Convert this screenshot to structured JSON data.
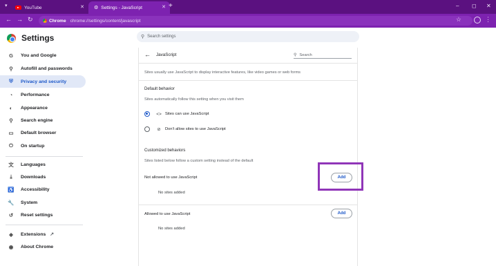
{
  "browser": {
    "tabs": [
      {
        "title": "YouTube",
        "icon": "youtube-logo-icon"
      },
      {
        "title": "Settings - JavaScript",
        "icon": "gear-icon"
      }
    ],
    "new_tab_glyph": "+",
    "address": {
      "chip_label": "Chrome",
      "url": "chrome://settings/content/javascript"
    },
    "colors": {
      "tabstrip": "#5b1180",
      "toolbar": "#7d22b0"
    }
  },
  "header": {
    "title": "Settings",
    "search_placeholder": "Search settings"
  },
  "sidebar": {
    "items": [
      {
        "label": "You and Google",
        "icon": "google-g-icon",
        "active": false
      },
      {
        "label": "Autofill and passwords",
        "icon": "key-icon",
        "active": false
      },
      {
        "label": "Privacy and security",
        "icon": "shield-icon",
        "active": true
      },
      {
        "label": "Performance",
        "icon": "speedometer-icon",
        "active": false
      },
      {
        "label": "Appearance",
        "icon": "palette-icon",
        "active": false
      },
      {
        "label": "Search engine",
        "icon": "search-icon",
        "active": false
      },
      {
        "label": "Default browser",
        "icon": "browser-window-icon",
        "active": false
      },
      {
        "label": "On startup",
        "icon": "power-icon",
        "active": false
      },
      {
        "label": "Languages",
        "icon": "translate-icon",
        "active": false
      },
      {
        "label": "Downloads",
        "icon": "download-icon",
        "active": false
      },
      {
        "label": "Accessibility",
        "icon": "accessibility-icon",
        "active": false
      },
      {
        "label": "System",
        "icon": "wrench-icon",
        "active": false
      },
      {
        "label": "Reset settings",
        "icon": "reset-icon",
        "active": false
      },
      {
        "label": "Extensions",
        "icon": "puzzle-icon",
        "active": false
      },
      {
        "label": "About Chrome",
        "icon": "chrome-logo-icon",
        "active": false
      }
    ]
  },
  "main": {
    "title": "JavaScript",
    "search_label": "Search",
    "intro": "Sites usually use JavaScript to display interactive features, like video games or web forms",
    "default_behavior": {
      "heading": "Default behavior",
      "subtext": "Sites automatically follow this setting when you visit them",
      "options": [
        {
          "label": "Sites can use JavaScript",
          "icon": "code-brackets-icon",
          "selected": true
        },
        {
          "label": "Don't allow sites to use JavaScript",
          "icon": "code-off-icon",
          "selected": false
        }
      ]
    },
    "customized": {
      "heading": "Customized behaviors",
      "subtext": "Sites listed below follow a custom setting instead of the default",
      "not_allowed": {
        "label": "Not allowed to use JavaScript",
        "empty": "No sites added",
        "button": "Add"
      },
      "allowed": {
        "label": "Allowed to use JavaScript",
        "empty": "No sites added",
        "button": "Add"
      }
    },
    "highlight_color": "#9035b8"
  }
}
